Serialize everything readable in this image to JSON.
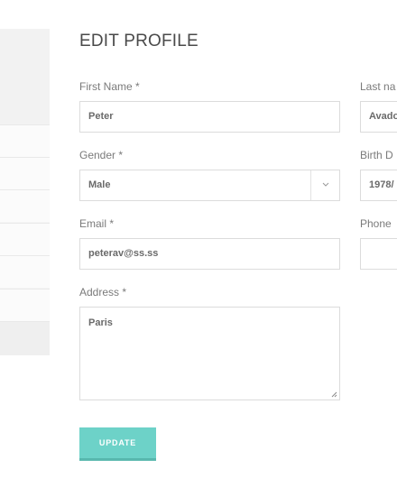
{
  "page": {
    "title": "EDIT PROFILE"
  },
  "form": {
    "first_name": {
      "label": "First Name *",
      "value": "Peter"
    },
    "last_name": {
      "label": "Last na",
      "value": "Avado"
    },
    "gender": {
      "label": "Gender *",
      "value": "Male"
    },
    "birth_date": {
      "label": "Birth D",
      "value": "1978/"
    },
    "email": {
      "label": "Email *",
      "value": "peterav@ss.ss"
    },
    "phone": {
      "label": "Phone",
      "value": ""
    },
    "address": {
      "label": "Address *",
      "value": "Paris"
    },
    "update_label": "UPDATE"
  },
  "icons": {
    "select_arrow": "chevron-down-icon",
    "resize": "resize-grip-icon"
  },
  "colors": {
    "accent": "#6dd2c8",
    "accent_dark": "#58b8ae"
  }
}
